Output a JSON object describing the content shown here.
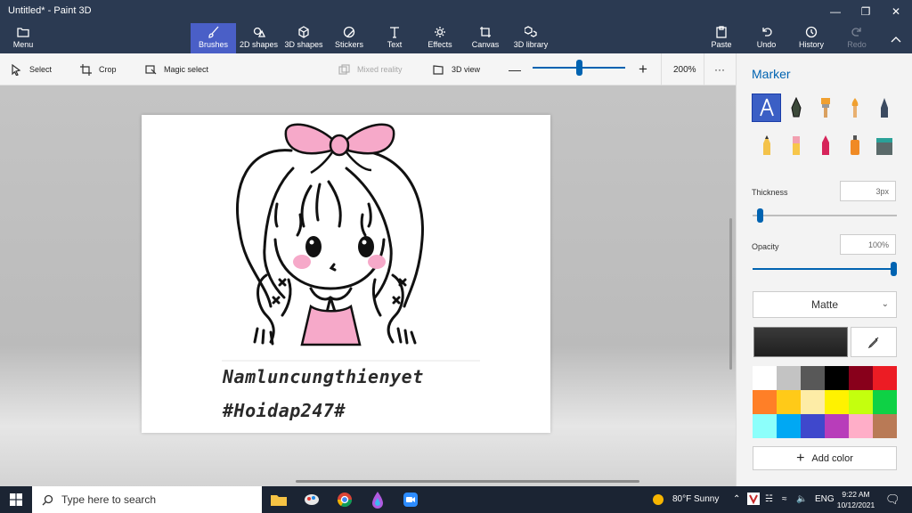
{
  "window": {
    "title": "Untitled* - Paint 3D"
  },
  "ribbon": {
    "menu": "Menu",
    "tabs": [
      "Brushes",
      "2D shapes",
      "3D shapes",
      "Stickers",
      "Text",
      "Effects",
      "Canvas",
      "3D library"
    ],
    "active_tab": "Brushes",
    "right_actions": [
      "Paste",
      "Undo",
      "History",
      "Redo"
    ]
  },
  "toolbar": {
    "select": "Select",
    "crop": "Crop",
    "magic_select": "Magic select",
    "mixed_reality": "Mixed reality",
    "view_3d": "3D view",
    "zoom": "200%",
    "zoom_level": 0.5,
    "more": "···"
  },
  "canvas": {
    "line1": "Namluncungthienyet",
    "line2": "#Hoidap247#"
  },
  "panel": {
    "title": "Marker",
    "brushes": [
      "marker-icon",
      "calligraphy-pen-icon",
      "oil-brush-icon",
      "watercolor-icon",
      "pixel-pen-icon",
      "pencil-icon",
      "eraser-icon",
      "crayon-icon",
      "spray-can-icon",
      "fill-icon"
    ],
    "thickness_label": "Thickness",
    "thickness_value": "3px",
    "thickness_level": 0.03,
    "opacity_label": "Opacity",
    "opacity_value": "100%",
    "opacity_level": 1.0,
    "finish": "Matte",
    "current_color": "#1f1f1f",
    "palette": [
      "#ffffff",
      "#c3c3c3",
      "#585858",
      "#000000",
      "#88001b",
      "#ec1c24",
      "#ff7f27",
      "#ffca18",
      "#fdeca6",
      "#fff200",
      "#c4ff0e",
      "#0ed145",
      "#8cfffb",
      "#00a8f3",
      "#3f48cc",
      "#b83dba",
      "#ffaec8",
      "#b97a56"
    ],
    "add_color": "Add color"
  },
  "taskbar": {
    "search_placeholder": "Type here to search",
    "weather": "80°F  Sunny",
    "language": "ENG",
    "time": "9:22 AM",
    "date": "10/12/2021"
  },
  "colors": {
    "accent": "#0063b1",
    "titlebar": "#2b3a52",
    "active_tab": "#4a5fc7"
  }
}
